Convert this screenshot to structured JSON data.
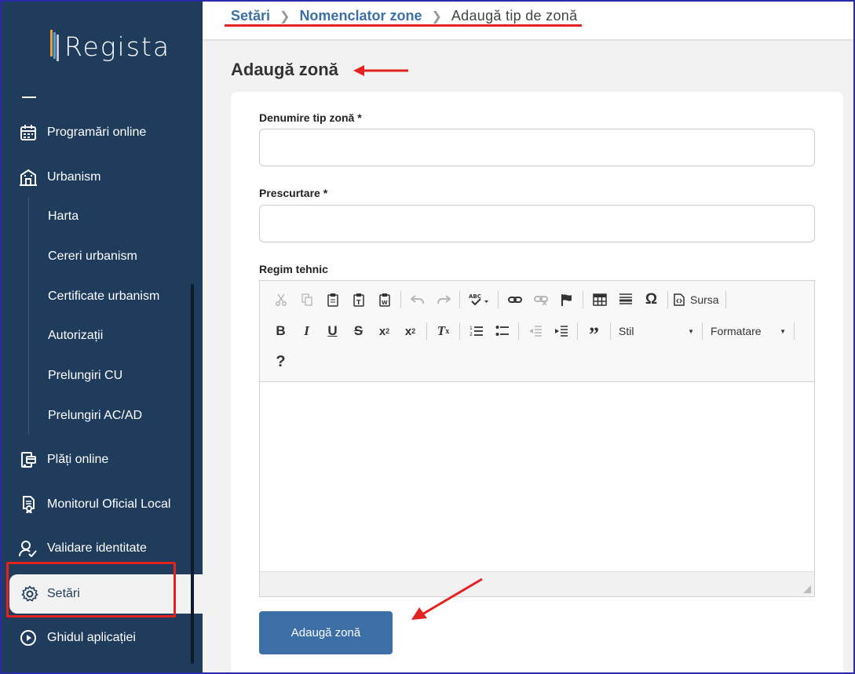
{
  "app": {
    "logo_text": "Regista"
  },
  "sidebar": {
    "items": [
      {
        "label": "Programări online",
        "icon": "calendar-icon"
      },
      {
        "label": "Urbanism",
        "icon": "building-icon"
      },
      {
        "label": "Plăți online",
        "icon": "payment-terminal-icon"
      },
      {
        "label": "Monitorul Oficial Local",
        "icon": "certificate-document-icon"
      },
      {
        "label": "Validare identitate",
        "icon": "user-check-icon"
      },
      {
        "label": "Setări",
        "icon": "gear-icon",
        "active": true
      },
      {
        "label": "Ghidul aplicației",
        "icon": "play-circle-icon"
      }
    ],
    "urbanism_sub": [
      "Harta",
      "Cereri urbanism",
      "Certificate urbanism",
      "Autorizații",
      "Prelungiri CU",
      "Prelungiri AC/AD"
    ]
  },
  "breadcrumb": {
    "items": [
      "Setări",
      "Nomenclator zone"
    ],
    "current": "Adaugă tip de zonă"
  },
  "page": {
    "title": "Adaugă zonă"
  },
  "form": {
    "name_label": "Denumire tip zonă *",
    "name_value": "",
    "abbr_label": "Prescurtare *",
    "abbr_value": "",
    "regime_label": "Regim tehnic",
    "editor": {
      "source_label": "Sursa",
      "style_label": "Stil",
      "format_label": "Formatare",
      "help_label": "?"
    },
    "submit_label": "Adaugă zonă"
  },
  "colors": {
    "sidebar": "#1f3c5c",
    "primary": "#3c6fa6",
    "annotation": "#e52222"
  }
}
